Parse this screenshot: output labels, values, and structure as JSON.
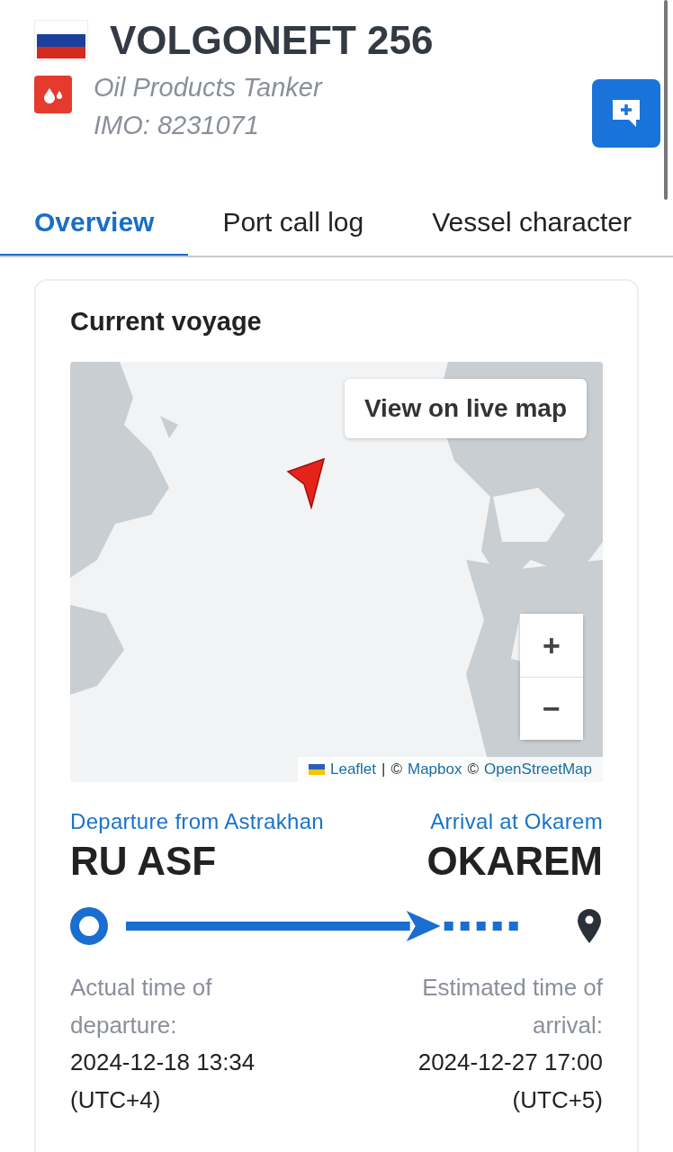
{
  "vessel": {
    "name": "VOLGONEFT 256",
    "type": "Oil Products Tanker",
    "imo": "IMO: 8231071"
  },
  "tabs": [
    {
      "label": "Overview",
      "selected": true
    },
    {
      "label": "Port call log",
      "selected": false
    },
    {
      "label": "Vessel character",
      "selected": false
    }
  ],
  "voyage": {
    "title": "Current voyage",
    "map": {
      "kind": "picture",
      "live_map_button": "View on live map",
      "zoom_in": "+",
      "zoom_out": "−",
      "attribution": [
        {
          "text": "Leaflet",
          "kind": "link"
        },
        {
          "text": "|",
          "kind": "text"
        },
        {
          "text": "©",
          "kind": "text"
        },
        {
          "text": "Mapbox",
          "kind": "link"
        },
        {
          "text": "©",
          "kind": "text"
        },
        {
          "text": "OpenStreetMap",
          "kind": "link"
        }
      ]
    },
    "departure": {
      "label": "Departure from Astrakhan",
      "code": "RU ASF",
      "time_label": "Actual time of departure:",
      "time": "2024-12-18 13:34",
      "zone": "(UTC+4)"
    },
    "arrival": {
      "label": "Arrival at Okarem",
      "code": "OKAREM",
      "time_label": "Estimated time of arrival:",
      "time": "2024-12-27 17:00",
      "zone": "(UTC+5)"
    },
    "progress": {
      "level": 0.77
    }
  }
}
